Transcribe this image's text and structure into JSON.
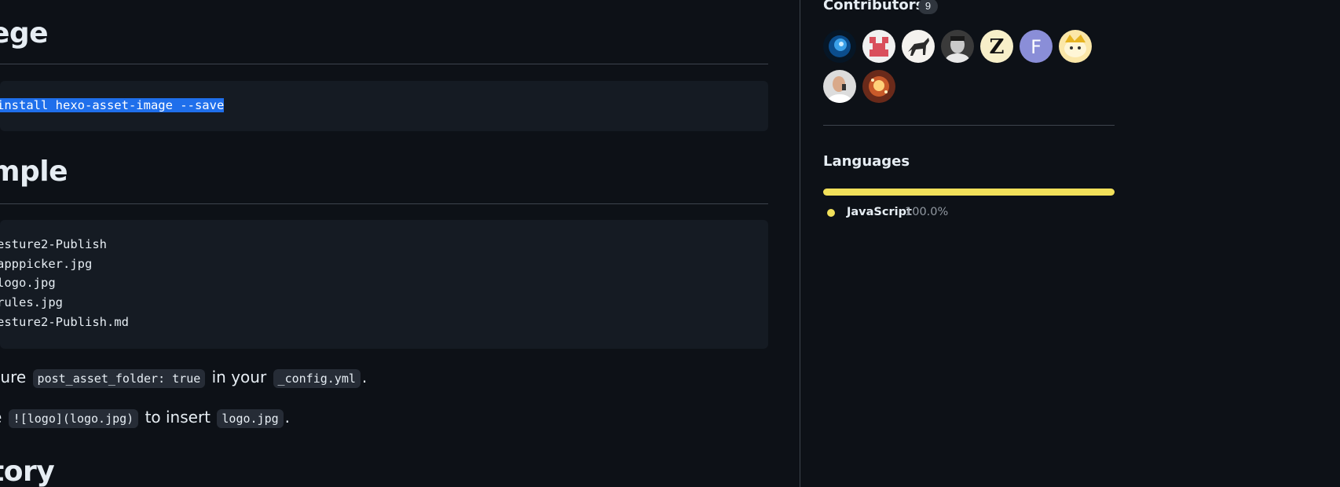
{
  "readme": {
    "heading_install": "ege",
    "install_command": "install hexo-asset-image --save",
    "heading_example": "mple",
    "tree_lines": [
      "esture2-Publish",
      "apppicker.jpg",
      "logo.jpg",
      "rules.jpg",
      "esture2-Publish.md"
    ],
    "para1": {
      "prefix": "sure",
      "code1": "post_asset_folder: true",
      "middle": "in your",
      "code2": "_config.yml",
      "suffix": "."
    },
    "para2": {
      "prefix": "e",
      "code1": "![logo](logo.jpg)",
      "middle": "to insert",
      "code2": "logo.jpg",
      "suffix": "."
    },
    "heading_history": "tory"
  },
  "sidebar": {
    "contributors_title": "Contributors",
    "contributors_count": "9",
    "avatars": [
      "avatar-galaxy",
      "avatar-red-pixel",
      "avatar-horse",
      "avatar-portrait",
      "avatar-letter-z",
      "avatar-letter-f",
      "avatar-cartoon",
      "avatar-photo",
      "avatar-sparkle"
    ],
    "languages_title": "Languages",
    "languages": [
      {
        "name": "JavaScript",
        "percent": "100.0%",
        "fraction": 1.0,
        "color": "#f1e05a"
      }
    ]
  },
  "colors": {
    "background": "#0d1117",
    "code_background": "#151b23",
    "selection": "#1f6feb",
    "border": "#3d444d"
  }
}
